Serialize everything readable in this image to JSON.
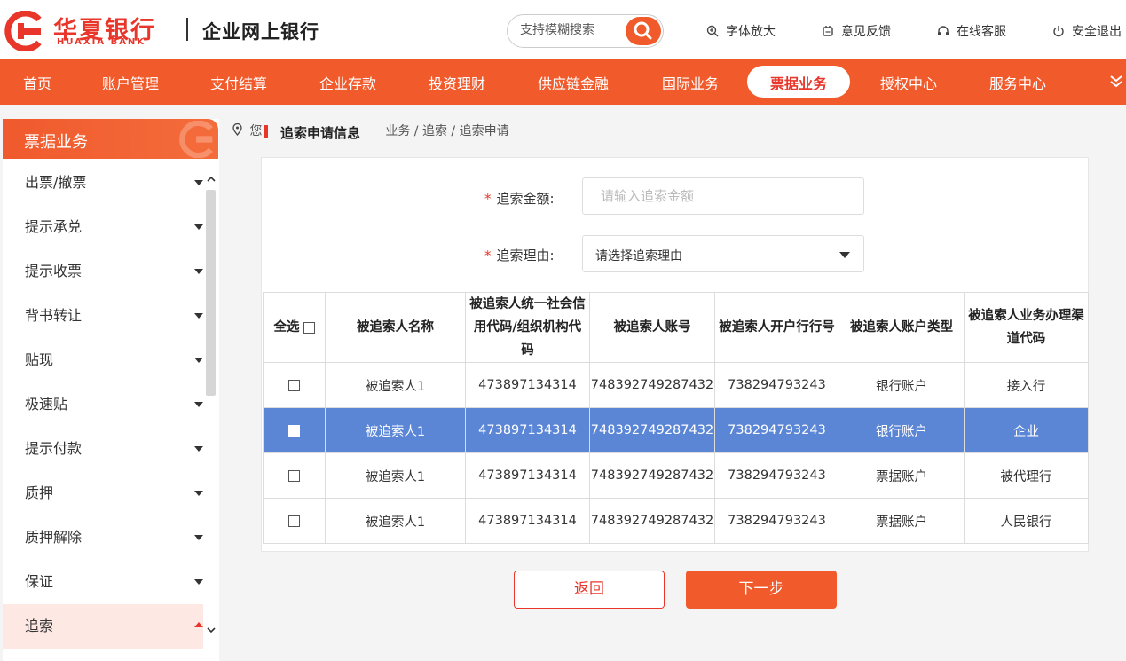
{
  "brand": {
    "name_cn": "华夏银行",
    "name_en": "HUAXIA BANK",
    "portal": "企业网上银行",
    "color": "#e8362a"
  },
  "search": {
    "placeholder": "支持模糊搜索"
  },
  "tools": {
    "font_zoom": "字体放大",
    "feedback": "意见反馈",
    "service": "在线客服",
    "logout": "安全退出"
  },
  "nav": {
    "items": [
      "首页",
      "账户管理",
      "支付结算",
      "企业存款",
      "投资理财",
      "供应链金融",
      "国际业务",
      "票据业务",
      "授权中心",
      "服务中心"
    ],
    "active": "票据业务"
  },
  "sidebar": {
    "title": "票据业务",
    "items": [
      "出票/撤票",
      "提示承兑",
      "提示收票",
      "背书转让",
      "贴现",
      "极速贴",
      "提示付款",
      "质押",
      "质押解除",
      "保证",
      "追索"
    ],
    "active": "追索"
  },
  "breadcrumb": {
    "prefix": "您",
    "path": "业务 / 追索 / 追索申请"
  },
  "section": {
    "title": "追索申请信息"
  },
  "form": {
    "amount_label": "追索金额:",
    "amount_placeholder": "请输入追索金额",
    "reason_label": "追索理由:",
    "reason_value": "请选择追索理由"
  },
  "table": {
    "select_all": "全选",
    "headers": [
      "被追索人名称",
      "被追索人统一社会信用代码/组织机构代码",
      "被追索人账号",
      "被追索人开户行行号",
      "被追索人账户类型",
      "被追索人业务办理渠道代码"
    ],
    "rows": [
      {
        "name": "被追索人1",
        "credit_code": "473897134314",
        "account": "748392749287432",
        "bank_no": "738294793243",
        "account_type": "银行账户",
        "channel": "接入行",
        "selected": false
      },
      {
        "name": "被追索人1",
        "credit_code": "473897134314",
        "account": "748392749287432",
        "bank_no": "738294793243",
        "account_type": "银行账户",
        "channel": "企业",
        "selected": true
      },
      {
        "name": "被追索人1",
        "credit_code": "473897134314",
        "account": "748392749287432",
        "bank_no": "738294793243",
        "account_type": "票据账户",
        "channel": "被代理行",
        "selected": false
      },
      {
        "name": "被追索人1",
        "credit_code": "473897134314",
        "account": "748392749287432",
        "bank_no": "738294793243",
        "account_type": "票据账户",
        "channel": "人民银行",
        "selected": false
      }
    ],
    "selected_color": "#5b86d6"
  },
  "buttons": {
    "back": "返回",
    "next": "下一步"
  }
}
